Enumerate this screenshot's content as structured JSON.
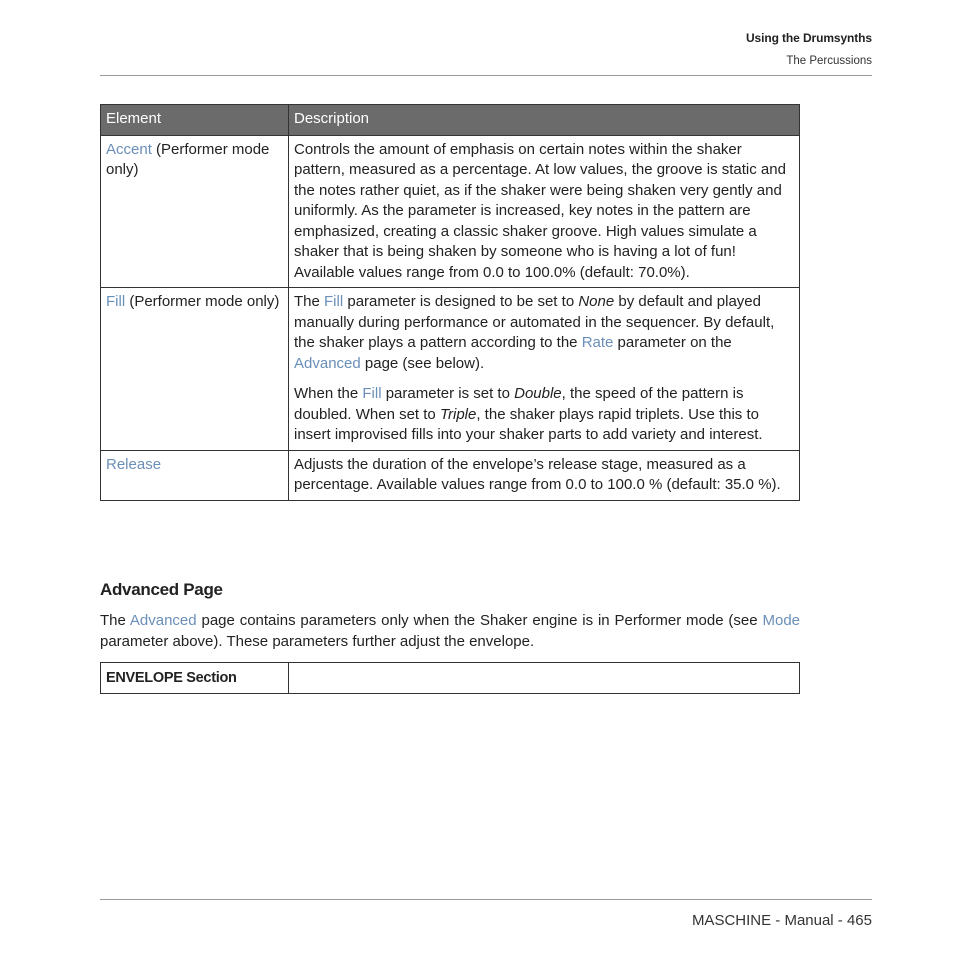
{
  "header": {
    "chapter": "Using the Drumsynths",
    "section": "The Percussions"
  },
  "table": {
    "columns": [
      "Element",
      "Description"
    ],
    "rows": [
      {
        "element_link": "Accent",
        "element_rest": " (Performer mode only)",
        "description": "Controls the amount of emphasis on certain notes within the shaker pattern, measured as a percentage. At low values, the groove is static and the notes rather quiet, as if the shaker were being shaken very gently and uniformly. As the parameter is increased, key notes in the pattern are emphasized, creating a classic shaker groove. High values simulate a shaker that is being shaken by someone who is having a lot of fun! Available values range from 0.0 to 100.0% (default: 70.0%)."
      },
      {
        "element_link": "Fill",
        "element_rest": " (Performer mode only)",
        "p1": {
          "t1": "The ",
          "link1": "Fill",
          "t2": " parameter is designed to be set to ",
          "em1": "None",
          "t3": " by default and played manually during performance or automated in the sequencer. By default, the shaker plays a pattern according to the ",
          "link2": "Rate",
          "t4": " parameter on the ",
          "link3": "Advanced",
          "t5": " page (see below)."
        },
        "p2": {
          "t1": "When the ",
          "link1": "Fill",
          "t2": " parameter is set to ",
          "em1": "Double",
          "t3": ", the speed of the pattern is doubled. When set to ",
          "em2": "Triple",
          "t4": ", the shaker plays rapid triplets. Use this to insert improvised fills into your shaker parts to add variety and interest."
        }
      },
      {
        "element_link": "Release",
        "description": "Adjusts the duration of the envelope’s release stage, measured as a percentage. Available values range from 0.0 to 100.0 % (default: 35.0 %)."
      }
    ]
  },
  "advanced": {
    "heading": "Advanced Page",
    "t1": "The ",
    "link1": "Advanced",
    "t2": " page contains parameters only when the Shaker engine is in Performer mode (see ",
    "link2": "Mode",
    "t3": " parameter above). These parameters further adjust the envelope."
  },
  "envelope_table": {
    "label": "ENVELOPE Section",
    "value": ""
  },
  "footer": {
    "text": "MASCHINE - Manual - 465"
  },
  "colors": {
    "link": "#6a8fb8",
    "table_header_bg": "#6b6b6b"
  }
}
